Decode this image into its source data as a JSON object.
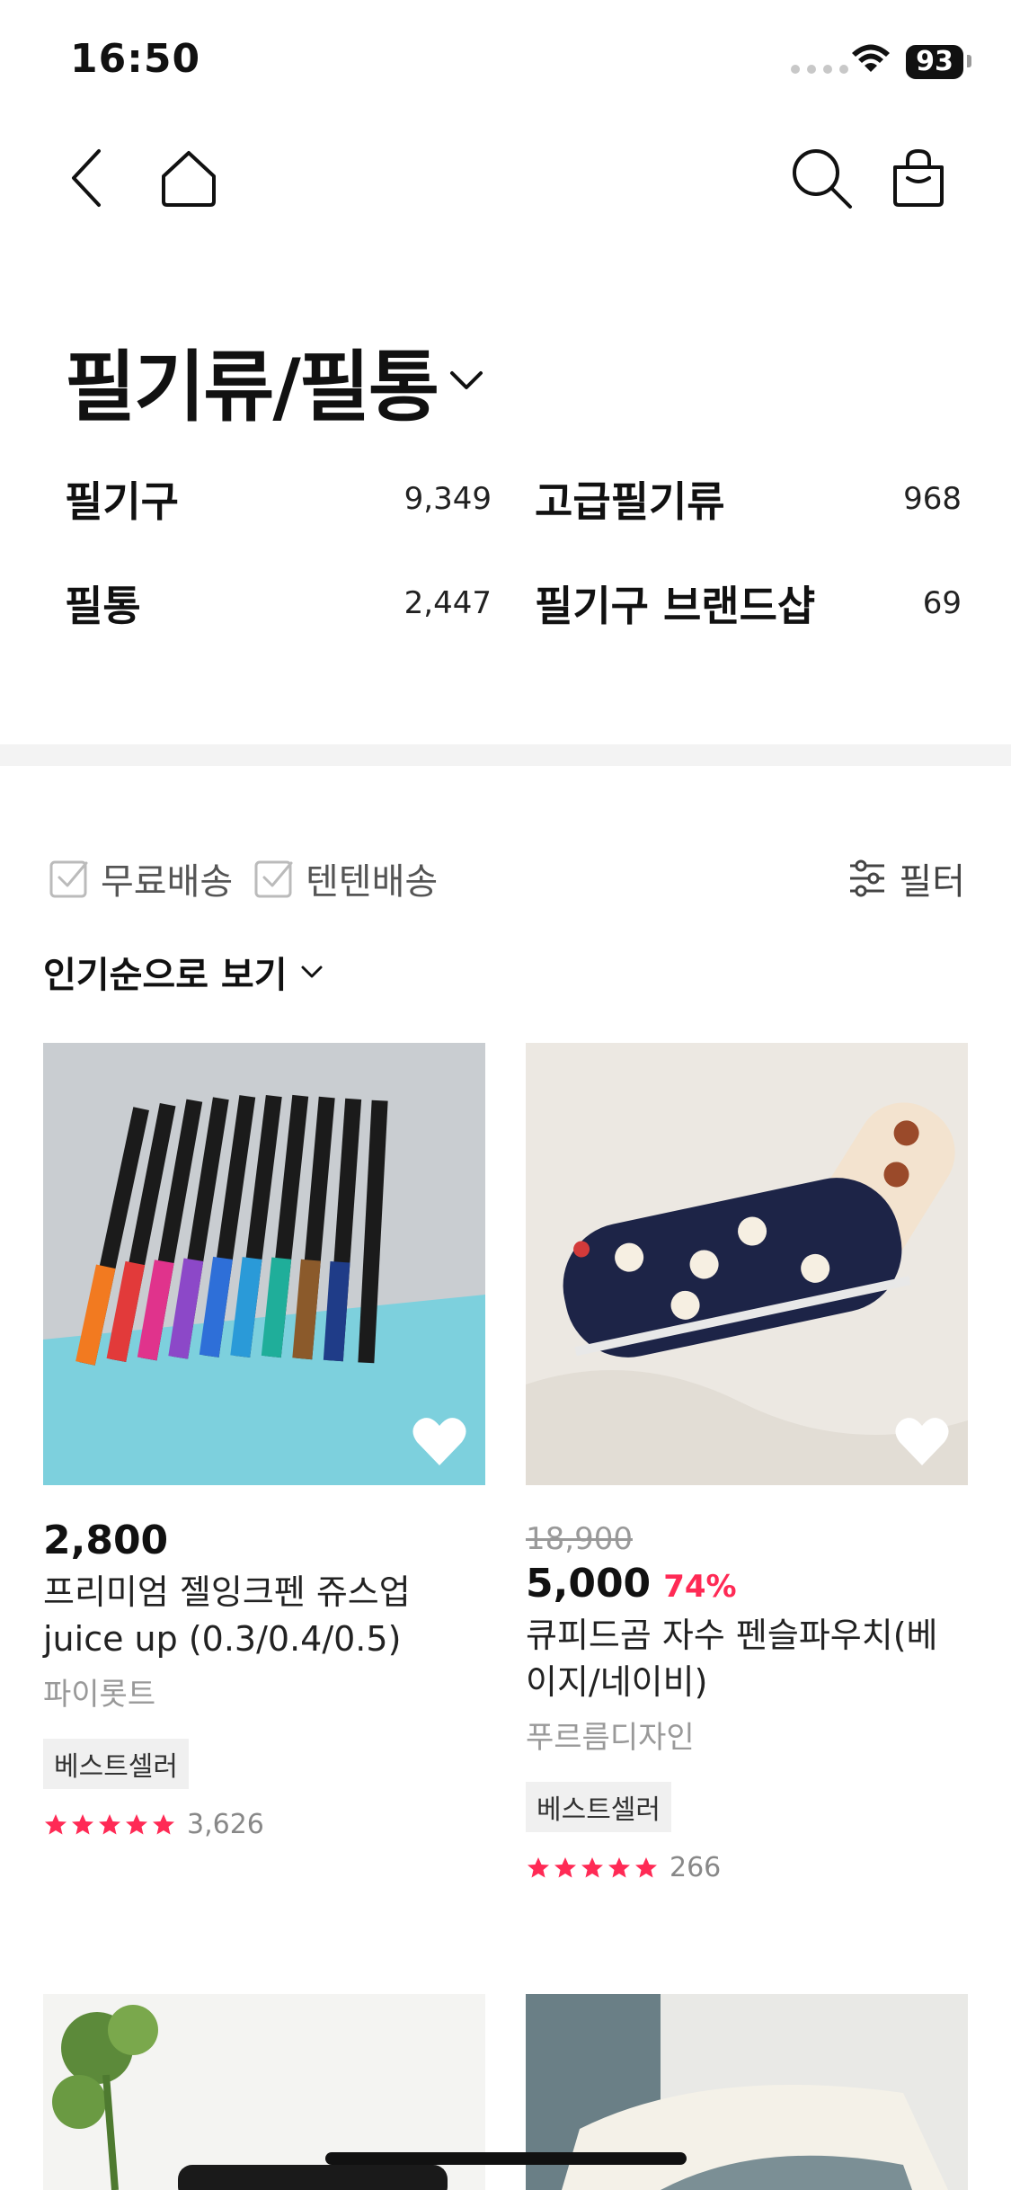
{
  "status": {
    "time": "16:50",
    "battery": "93"
  },
  "category": {
    "title": "필기류/필통",
    "subcategories": [
      {
        "name": "필기구",
        "count": "9,349"
      },
      {
        "name": "고급필기류",
        "count": "968"
      },
      {
        "name": "필통",
        "count": "2,447"
      },
      {
        "name": "필기구 브랜드샵",
        "count": "69"
      }
    ]
  },
  "filters": {
    "free_shipping": "무료배송",
    "tenten_shipping": "텐텐배송",
    "filter_label": "필터",
    "sort_label": "인기순으로 보기"
  },
  "products": [
    {
      "price": "2,800",
      "name": "프리미엄 젤잉크펜 쥬스업 juice up (0.3/0.4/0.5)",
      "brand": "파이롯트",
      "badge": "베스트셀러",
      "rating_count": "3,626"
    },
    {
      "original_price": "18,900",
      "price": "5,000",
      "discount": "74%",
      "name": "큐피드곰 자수 펜슬파우치(베이지/네이비)",
      "brand": "푸르름디자인",
      "badge": "베스트셀러",
      "rating_count": "266"
    }
  ],
  "colors": {
    "accent": "#ff2a55",
    "divider": "#f3f3f3"
  },
  "icons": [
    "back-icon",
    "home-icon",
    "search-icon",
    "shopping-bag-icon",
    "chevron-down-icon",
    "checkbox-icon",
    "filter-sliders-icon",
    "heart-icon",
    "star-icon"
  ]
}
